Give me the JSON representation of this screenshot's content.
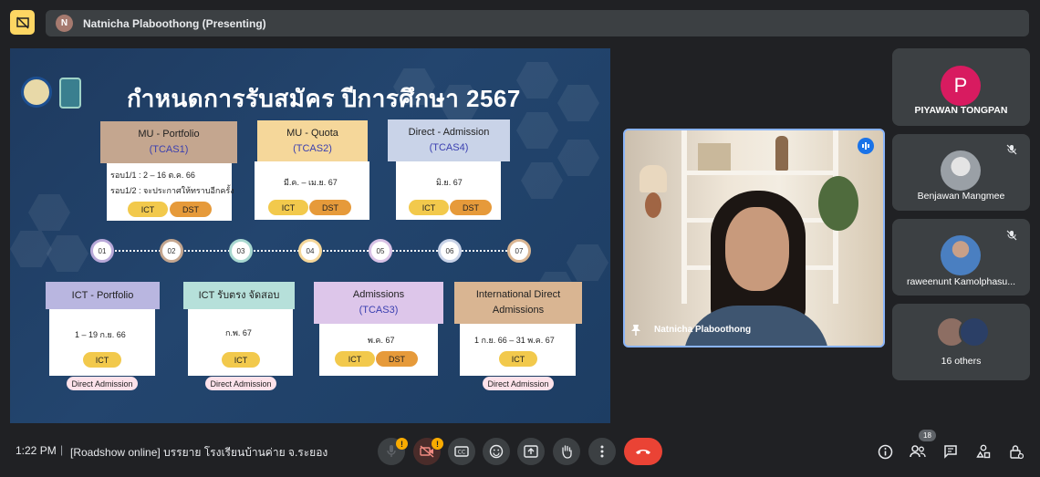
{
  "top": {
    "presenter_initial": "N",
    "presenting_label": "Natnicha Plaboothong (Presenting)"
  },
  "slide": {
    "title": "กำหนดการรับสมัคร ปีการศึกษา 2567",
    "top_cards": [
      {
        "title": "MU - Portfolio",
        "sub": "(TCAS1)",
        "lines": [
          "รอบ1/1 : 2 – 16 ต.ค. 66",
          "รอบ1/2 : จะประกาศให้ทราบอีกครั้ง"
        ],
        "pills": [
          "ICT",
          "DST"
        ]
      },
      {
        "title": "MU - Quota",
        "sub": "(TCAS2)",
        "lines": [
          "มี.ค. – เม.ย. 67"
        ],
        "pills": [
          "ICT",
          "DST"
        ]
      },
      {
        "title": "Direct - Admission",
        "sub": "(TCAS4)",
        "lines": [
          "มิ.ย. 67"
        ],
        "pills": [
          "ICT",
          "DST"
        ]
      }
    ],
    "nodes": [
      "01",
      "02",
      "03",
      "04",
      "05",
      "06",
      "07"
    ],
    "bottom_cards": [
      {
        "title": "ICT - Portfolio",
        "lines": [
          "1 – 19 ก.ย. 66"
        ],
        "pills": [
          "ICT"
        ],
        "tag": "Direct Admission"
      },
      {
        "title": "ICT รับตรง จัดสอบ",
        "lines": [
          "ก.พ. 67"
        ],
        "pills": [
          "ICT"
        ],
        "tag": "Direct Admission"
      },
      {
        "title": "Admissions",
        "sub": "(TCAS3)",
        "lines": [
          "พ.ค. 67"
        ],
        "pills": [
          "ICT",
          "DST"
        ]
      },
      {
        "title": "International Direct",
        "title2": "Admissions",
        "lines": [
          "1 ก.ย. 66 – 31 พ.ค. 67"
        ],
        "pills": [
          "ICT"
        ],
        "tag": "Direct Admission"
      }
    ]
  },
  "video": {
    "name": "Natnicha Plaboothong"
  },
  "participants": [
    {
      "initial": "P",
      "name": "PIYAWAN TONGPAN",
      "color": "#d81b60"
    },
    {
      "name": "Benjawan Mangmee"
    },
    {
      "name": "raweenunt Kamolphasu..."
    },
    {
      "name": "16 others"
    }
  ],
  "bottom": {
    "time": "1:22 PM",
    "separator": "|",
    "meeting_title": "[Roadshow online] บรรยาย โรงเรียนบ้านค่าย จ.ระยอง",
    "mic_badge": "!",
    "cam_badge": "!",
    "people_count": "18"
  },
  "colors": {
    "accent": "#8ab4f8",
    "end_call": "#ea4335",
    "badge": "#f9ab00"
  }
}
